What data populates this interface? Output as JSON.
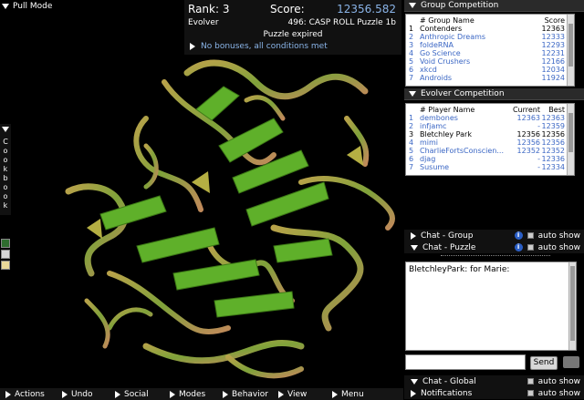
{
  "pull_mode": {
    "label": "Pull Mode"
  },
  "score": {
    "rank_label": "Rank: 3",
    "score_label": "Score:",
    "score_value": "12356.582",
    "team": "Evolver",
    "puzzle": "496: CASP ROLL Puzzle 1b",
    "status": "Puzzle expired",
    "bonus": "No bonuses, all conditions met"
  },
  "cookbook": {
    "letters": [
      "C",
      "o",
      "o",
      "k",
      "b",
      "o",
      "o",
      "k"
    ]
  },
  "group_competition": {
    "title": "Group Competition",
    "headers": [
      "# Group Name",
      "Score"
    ],
    "rows": [
      {
        "rank": "1",
        "name": "Contenders",
        "score": "12363",
        "color": "black"
      },
      {
        "rank": "2",
        "name": "Anthropic Dreams",
        "score": "12333",
        "color": "blue"
      },
      {
        "rank": "3",
        "name": "foldeRNA",
        "score": "12293",
        "color": "blue"
      },
      {
        "rank": "4",
        "name": "Go Science",
        "score": "12231",
        "color": "blue"
      },
      {
        "rank": "5",
        "name": "Void Crushers",
        "score": "12166",
        "color": "blue"
      },
      {
        "rank": "6",
        "name": "xkcd",
        "score": "12034",
        "color": "blue"
      },
      {
        "rank": "7",
        "name": "Androids",
        "score": "11924",
        "color": "blue"
      }
    ]
  },
  "evolver_competition": {
    "title": "Evolver Competition",
    "headers": [
      "# Player Name",
      "Current",
      "Best"
    ],
    "rows": [
      {
        "rank": "1",
        "name": "dembones",
        "current": "12363",
        "best": "12363",
        "color": "blue"
      },
      {
        "rank": "2",
        "name": "infjamc",
        "current": "-",
        "best": "12359",
        "color": "blue"
      },
      {
        "rank": "3",
        "name": "Bletchley Park",
        "current": "12356",
        "best": "12356",
        "color": "black"
      },
      {
        "rank": "4",
        "name": "mimi",
        "current": "12356",
        "best": "12356",
        "color": "blue"
      },
      {
        "rank": "5",
        "name": "CharlieFortsConscien...",
        "current": "12352",
        "best": "12352",
        "color": "blue"
      },
      {
        "rank": "6",
        "name": "djag",
        "current": "-",
        "best": "12336",
        "color": "blue"
      },
      {
        "rank": "7",
        "name": "Susume",
        "current": "-",
        "best": "12334",
        "color": "blue"
      }
    ]
  },
  "chat": {
    "group_label": "Chat - Group",
    "puzzle_label": "Chat - Puzzle",
    "auto_show": "auto show",
    "message_user": "BletchleyPark:",
    "message_text": " for Marie:",
    "send_label": "Send",
    "global_label": "Chat - Global",
    "notifications_label": "Notifications"
  },
  "menu": [
    "Actions",
    "Undo",
    "Social",
    "Modes",
    "Behavior",
    "View",
    "Menu"
  ],
  "colors": {
    "accent_blue": "#8ab4e8",
    "link_blue": "#3a66c4",
    "backbone_green": "#7aa33a",
    "backbone_tan": "#c9a25a",
    "sheet_green": "#5fb02a"
  }
}
